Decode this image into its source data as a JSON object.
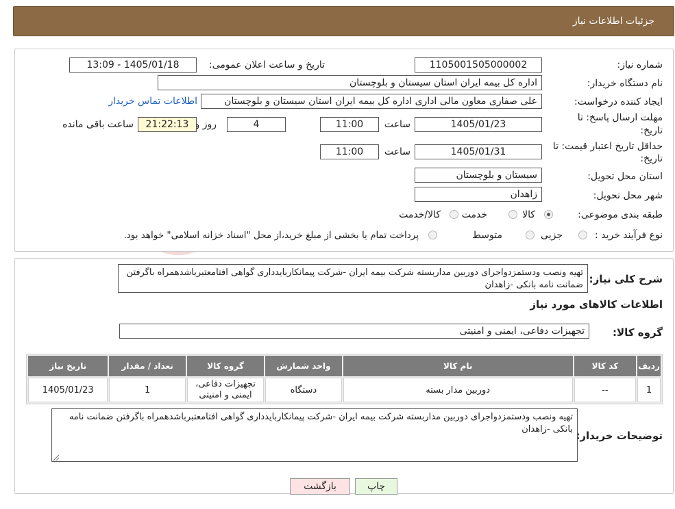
{
  "header": {
    "title": "جزئیات اطلاعات نیاز"
  },
  "form": {
    "need_number_label": "شماره نیاز:",
    "need_number": "1105001505000002",
    "announce_label": "تاریخ و ساعت اعلان عمومی:",
    "announce_value": "1405/01/18 - 13:09",
    "buyer_org_label": "نام دستگاه خریدار:",
    "buyer_org": "اداره کل بیمه ایران استان سیستان و بلوچستان",
    "creator_label": "ایجاد کننده درخواست:",
    "creator": "علی صفاری معاون مالی اداری اداره کل بیمه ایران استان سیستان و بلوچستان",
    "contact_link": "اطلاعات تماس خریدار",
    "deadline_label_1": "مهلت ارسال پاسخ: تا",
    "deadline_label_2": "تاریخ:",
    "deadline_date": "1405/01/23",
    "time_label": "ساعت",
    "deadline_time": "11:00",
    "days_value": "4",
    "days_label": "روز و",
    "remaining_time": "21:22:13",
    "remaining_label": "ساعت باقی مانده",
    "validity_label_1": "حداقل تاریخ اعتبار قیمت: تا",
    "validity_label_2": "تاریخ:",
    "validity_date": "1405/01/31",
    "validity_time": "11:00",
    "province_label": "استان محل تحویل:",
    "province": "سیستان و بلوچستان",
    "city_label": "شهر محل تحویل:",
    "city": "زاهدان",
    "category_label": "طبقه بندی موضوعی:",
    "category_options": [
      "کالا",
      "خدمت",
      "کالا/خدمت"
    ],
    "purchase_type_label": "نوع فرآیند خرید :",
    "purchase_options": [
      "جزیی",
      "متوسط"
    ],
    "payment_note": "پرداخت تمام یا بخشی از مبلغ خرید،از محل \"اسناد خزانه اسلامی\" خواهد بود."
  },
  "description": {
    "label": "شرح کلی نیاز:",
    "text": "تهیه ونصب ودستمزدواجرای دوربین مداربسته  شرکت بیمه ایران -شرکت پیمانکاربایدداری گواهی افتامعتبرباشدهمراه باگرفتن ضمانت نامه بانکی -زاهدان"
  },
  "goods": {
    "section_title": "اطلاعات کالاهای مورد نیاز",
    "group_label": "گروه کالا:",
    "group_value": "تجهیزات دفاعی، ایمنی و امنیتی",
    "columns": [
      "ردیف",
      "کد کالا",
      "نام کالا",
      "واحد شمارش",
      "گروه کالا",
      "تعداد / مقدار",
      "تاریخ نیاز"
    ],
    "rows": [
      [
        "1",
        "--",
        "دوربین مدار بسته",
        "دستگاه",
        "تجهیزات دفاعی، ایمنی و امنیتی",
        "1",
        "1405/01/23"
      ]
    ]
  },
  "buyer_notes": {
    "label": "توضیحات خریدار:",
    "text": "تهیه ونصب ودستمزدواجرای دوربین مداربسته  شرکت بیمه ایران -شرکت پیمانکاربایدداری گواهی افتامعتبرباشدهمراه باگرفتن ضمانت نامه بانکی -زاهدان"
  },
  "buttons": {
    "print": "چاپ",
    "back": "بازگشت"
  },
  "watermark": {
    "text": "AriaTender.neT"
  },
  "colors": {
    "header": "#8b6a45",
    "table_header": "#7c7c7c",
    "link": "#1a5fc1",
    "remaining_bg": "#fffbd5",
    "back_btn": "#fde3e3",
    "print_btn": "#e8f8df"
  }
}
